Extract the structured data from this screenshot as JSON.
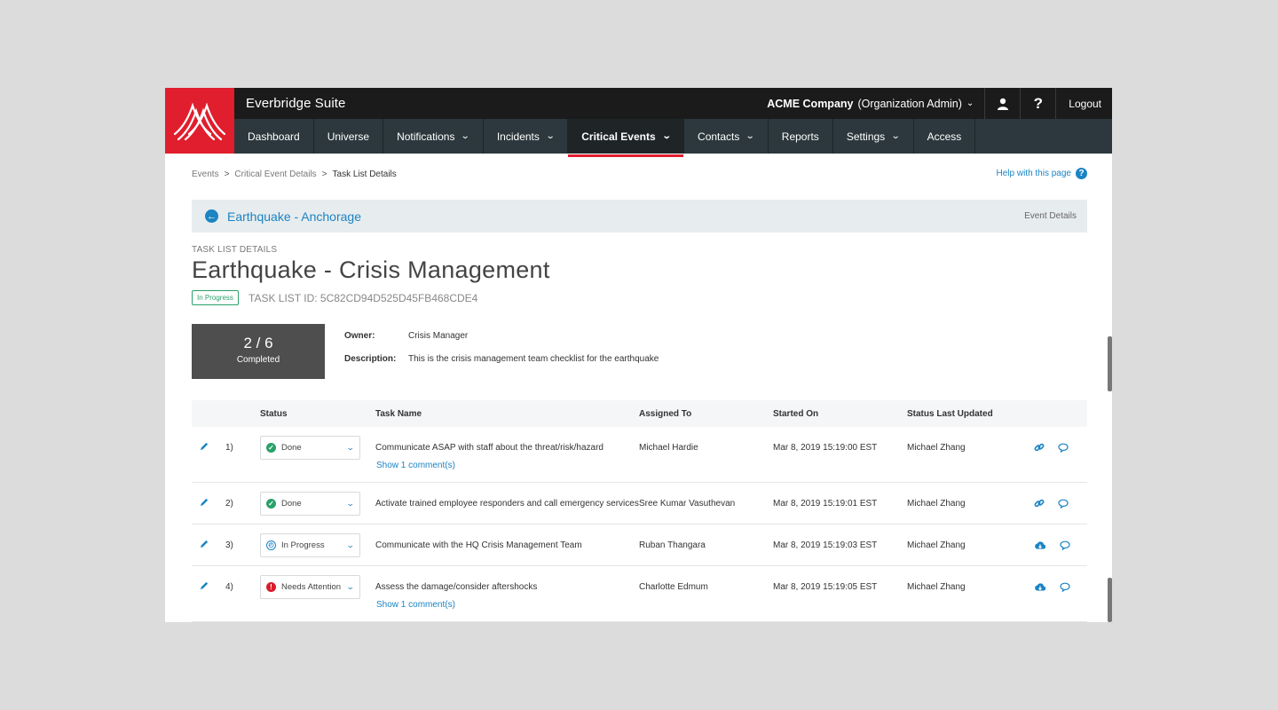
{
  "app": {
    "suite_name": "Everbridge Suite",
    "org_name": "ACME Company",
    "org_role": "(Organization Admin)",
    "logout": "Logout"
  },
  "nav": [
    {
      "label": "Dashboard",
      "has_menu": false,
      "active": false
    },
    {
      "label": "Universe",
      "has_menu": false,
      "active": false
    },
    {
      "label": "Notifications",
      "has_menu": true,
      "active": false
    },
    {
      "label": "Incidents",
      "has_menu": true,
      "active": false
    },
    {
      "label": "Critical Events",
      "has_menu": true,
      "active": true
    },
    {
      "label": "Contacts",
      "has_menu": true,
      "active": false
    },
    {
      "label": "Reports",
      "has_menu": false,
      "active": false
    },
    {
      "label": "Settings",
      "has_menu": true,
      "active": false
    },
    {
      "label": "Access",
      "has_menu": false,
      "active": false
    }
  ],
  "breadcrumb": {
    "items": [
      "Events",
      "Critical Event Details",
      "Task List Details"
    ],
    "separator": ">"
  },
  "help_link": "Help with this page",
  "event": {
    "title": "Earthquake - Anchorage",
    "details_link": "Event Details"
  },
  "task_list": {
    "section_label": "TASK LIST DETAILS",
    "title": "Earthquake - Crisis Management",
    "status": "In Progress",
    "id_label": "TASK LIST ID: 5C82CD94D525D45FB468CDE4",
    "progress_count": "2 / 6",
    "progress_label": "Completed",
    "owner_label": "Owner:",
    "owner": "Crisis Manager",
    "description_label": "Description:",
    "description": "This is the crisis management team checklist for the earthquake"
  },
  "table": {
    "headers": {
      "status": "Status",
      "task": "Task Name",
      "assigned": "Assigned To",
      "started": "Started On",
      "updated": "Status Last Updated"
    },
    "rows": [
      {
        "num": "1)",
        "status": "Done",
        "status_kind": "done",
        "task": "Communicate ASAP with staff about the threat/risk/hazard",
        "assigned": "Michael Hardie",
        "started": "Mar 8, 2019 15:19:00 EST",
        "updated_by": "Michael Zhang",
        "action_icon": "link-icon",
        "comments": "Show 1 comment(s)"
      },
      {
        "num": "2)",
        "status": "Done",
        "status_kind": "done",
        "task": "Activate trained employee responders and call emergency services",
        "assigned": "Sree Kumar Vasuthevan",
        "started": "Mar 8, 2019 15:19:01 EST",
        "updated_by": "Michael Zhang",
        "action_icon": "link-icon",
        "comments": ""
      },
      {
        "num": "3)",
        "status": "In Progress",
        "status_kind": "progress",
        "task": "Communicate with the HQ Crisis Management Team",
        "assigned": "Ruban Thangara",
        "started": "Mar 8, 2019 15:19:03 EST",
        "updated_by": "Michael Zhang",
        "action_icon": "cloud-download-icon",
        "comments": ""
      },
      {
        "num": "4)",
        "status": "Needs Attention",
        "status_kind": "attn",
        "task": "Assess the damage/consider aftershocks",
        "assigned": "Charlotte Edmum",
        "started": "Mar 8, 2019 15:19:05 EST",
        "updated_by": "Michael Zhang",
        "action_icon": "cloud-download-icon",
        "comments": "Show 1 comment(s)"
      }
    ]
  },
  "colors": {
    "brand_red": "#e01e2d",
    "link_blue": "#1b84c3",
    "done_green": "#2aa06a",
    "attention_red": "#d91c2a"
  }
}
